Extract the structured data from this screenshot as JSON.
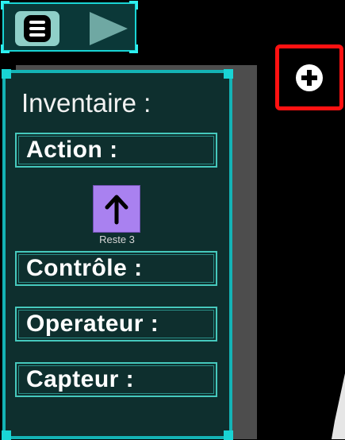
{
  "toolbar": {
    "menu_icon": "hamburger-menu-icon",
    "play_icon": "play-triangle-icon"
  },
  "inventory": {
    "title": "Inventaire :",
    "sections": [
      {
        "label": "Action :",
        "items": [
          {
            "icon": "up-arrow-icon",
            "count_text": "Reste 3"
          }
        ]
      },
      {
        "label": "Contrôle :",
        "items": []
      },
      {
        "label": "Operateur :",
        "items": []
      },
      {
        "label": "Capteur :",
        "items": []
      }
    ]
  },
  "add_button": {
    "icon": "plus-circle-icon",
    "highlight_color": "#ff1111"
  },
  "colors": {
    "panel_bg": "#0e2f2e",
    "accent": "#19d4d4",
    "item_card": "#a981f0"
  }
}
